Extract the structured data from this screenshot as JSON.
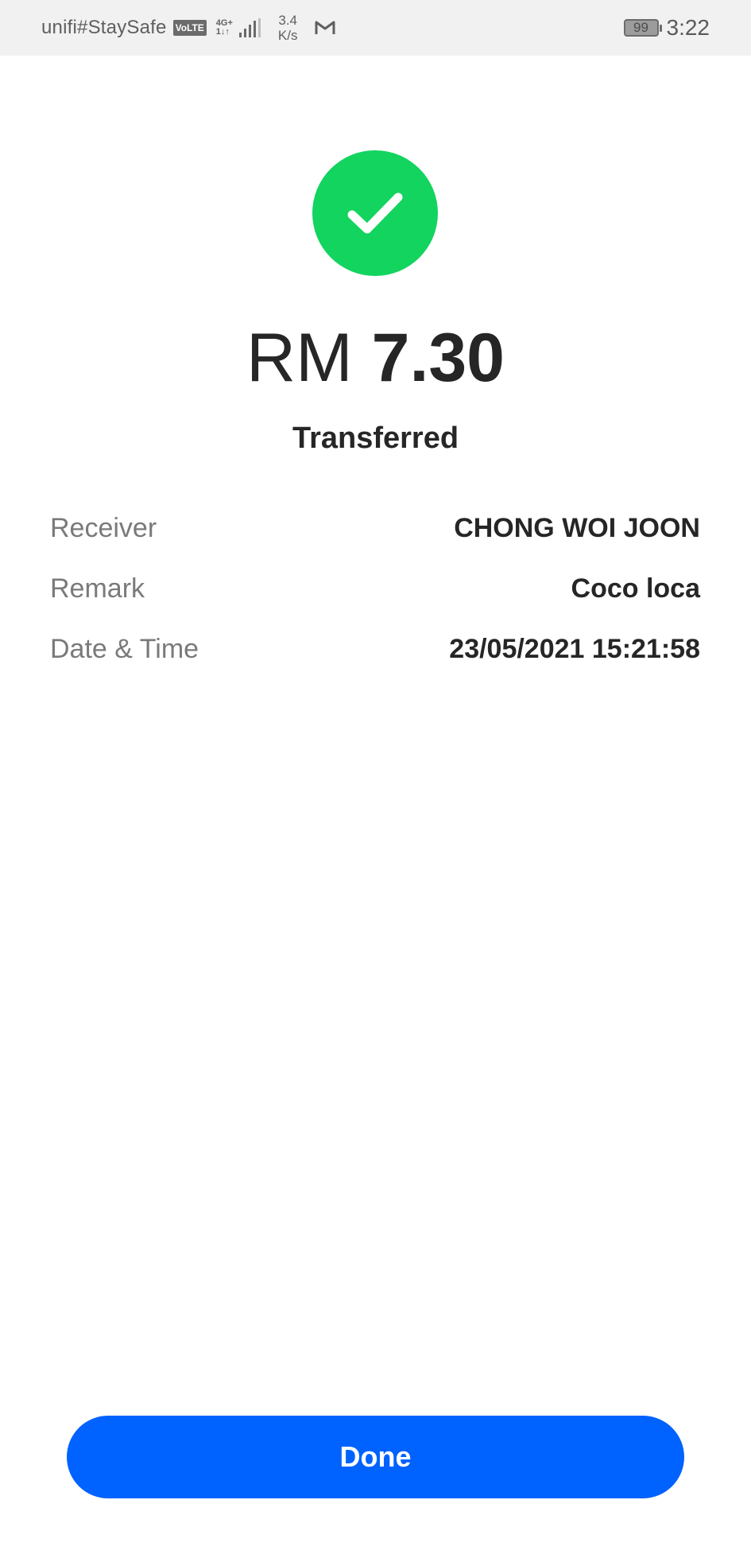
{
  "statusbar": {
    "carrier": "unifi#StaySafe",
    "volte": "VoLTE",
    "network_type": "4G+",
    "network_sub": "1↓↑",
    "speed_value": "3.4",
    "speed_unit": "K/s",
    "battery": "99",
    "time": "3:22"
  },
  "transaction": {
    "currency": "RM",
    "amount": "7.30",
    "status": "Transferred",
    "details": [
      {
        "label": "Receiver",
        "value": "CHONG WOI JOON"
      },
      {
        "label": "Remark",
        "value": "Coco loca"
      },
      {
        "label": "Date & Time",
        "value": "23/05/2021 15:21:58"
      }
    ]
  },
  "actions": {
    "done_label": "Done"
  },
  "colors": {
    "success": "#12d45e",
    "primary_button": "#0062ff",
    "text_primary": "#262626",
    "text_secondary": "#7a7a7a"
  }
}
